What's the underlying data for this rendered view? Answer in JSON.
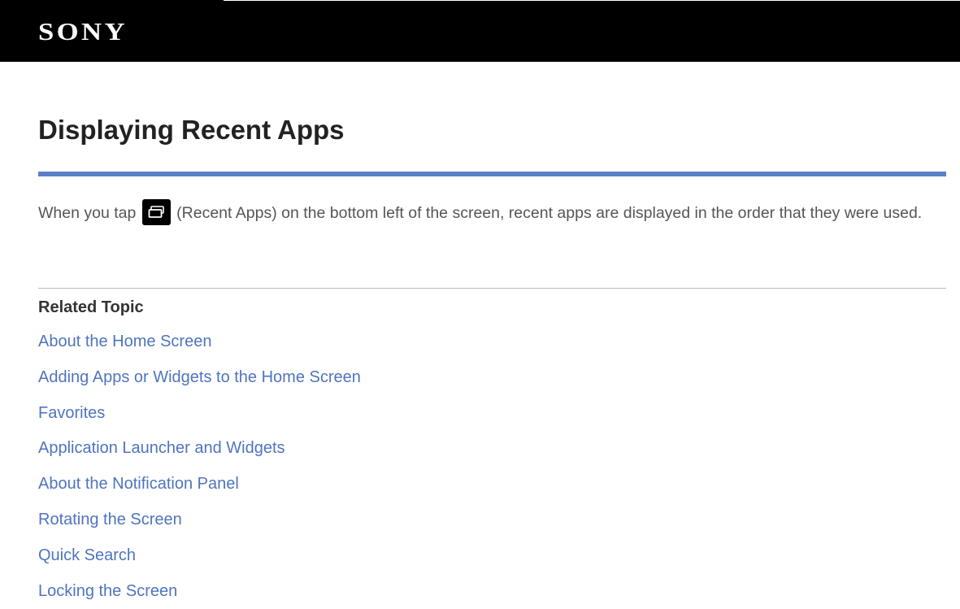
{
  "header": {
    "logo": "SONY"
  },
  "page": {
    "title": "Displaying Recent Apps",
    "body_before_icon": "When you tap ",
    "icon_name": "recent-apps-icon",
    "body_after_icon": " (Recent Apps) on the bottom left of the screen, recent apps are displayed in the order that they were used."
  },
  "related": {
    "heading": "Related Topic",
    "links": [
      "About the Home Screen",
      "Adding Apps or Widgets to the Home Screen",
      "Favorites",
      "Application Launcher and Widgets",
      "About the Notification Panel",
      "Rotating the Screen",
      "Quick Search",
      "Locking the Screen"
    ]
  },
  "colors": {
    "header_bg": "#000000",
    "accent_rule": "#5b7fc7",
    "link": "#4f74bf",
    "body_text": "#555555"
  }
}
